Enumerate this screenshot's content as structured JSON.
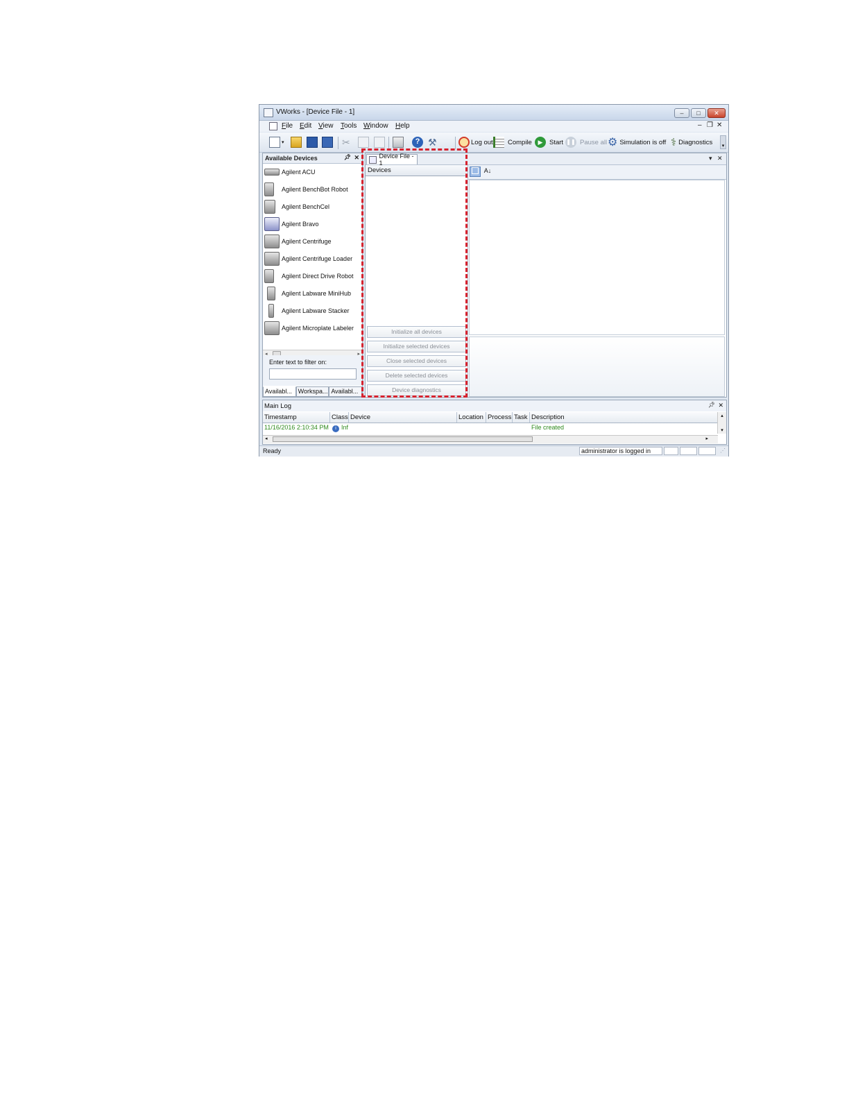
{
  "window": {
    "title": "VWorks - [Device File - 1]",
    "controls": {
      "minimize": "–",
      "maximize": "□",
      "close": "✕"
    }
  },
  "menu": {
    "items": [
      "File",
      "Edit",
      "View",
      "Tools",
      "Window",
      "Help"
    ],
    "mdi_controls": {
      "minimize": "–",
      "restore": "❐",
      "close": "✕"
    }
  },
  "toolbar": {
    "log_out": "Log out",
    "compile": "Compile",
    "start": "Start",
    "pause_all": "Pause all",
    "simulation": "Simulation is off",
    "diagnostics": "Diagnostics"
  },
  "available_devices": {
    "title": "Available Devices",
    "items": [
      "Agilent ACU",
      "Agilent BenchBot Robot",
      "Agilent BenchCel",
      "Agilent Bravo",
      "Agilent Centrifuge",
      "Agilent Centrifuge Loader",
      "Agilent Direct Drive Robot",
      "Agilent Labware MiniHub",
      "Agilent Labware Stacker",
      "Agilent Microplate Labeler"
    ],
    "filter_label": "Enter text to filter on:",
    "filter_value": "",
    "tabs": [
      "Availabl...",
      "Workspa...",
      "Availabl..."
    ]
  },
  "document": {
    "tab_label": "Device File - 1",
    "devices_header": "Devices",
    "actions": [
      "Initialize all devices",
      "Initialize selected devices",
      "Close selected devices",
      "Delete selected devices",
      "Device diagnostics"
    ],
    "sort_label": "A↓"
  },
  "main_log": {
    "title": "Main Log",
    "columns": [
      "Timestamp",
      "Class",
      "Device",
      "Location",
      "Process",
      "Task",
      "Description"
    ],
    "rows": [
      {
        "timestamp": "11/16/2016 2:10:34 PM",
        "class": "Inf",
        "device": "",
        "location": "",
        "process": "",
        "task": "",
        "description": "File created"
      }
    ],
    "row_color": "#2f8a1e"
  },
  "status": {
    "text": "Ready",
    "user": "administrator is logged in"
  },
  "colors": {
    "highlight": "#d6222e",
    "accent": "#5a83bb"
  }
}
